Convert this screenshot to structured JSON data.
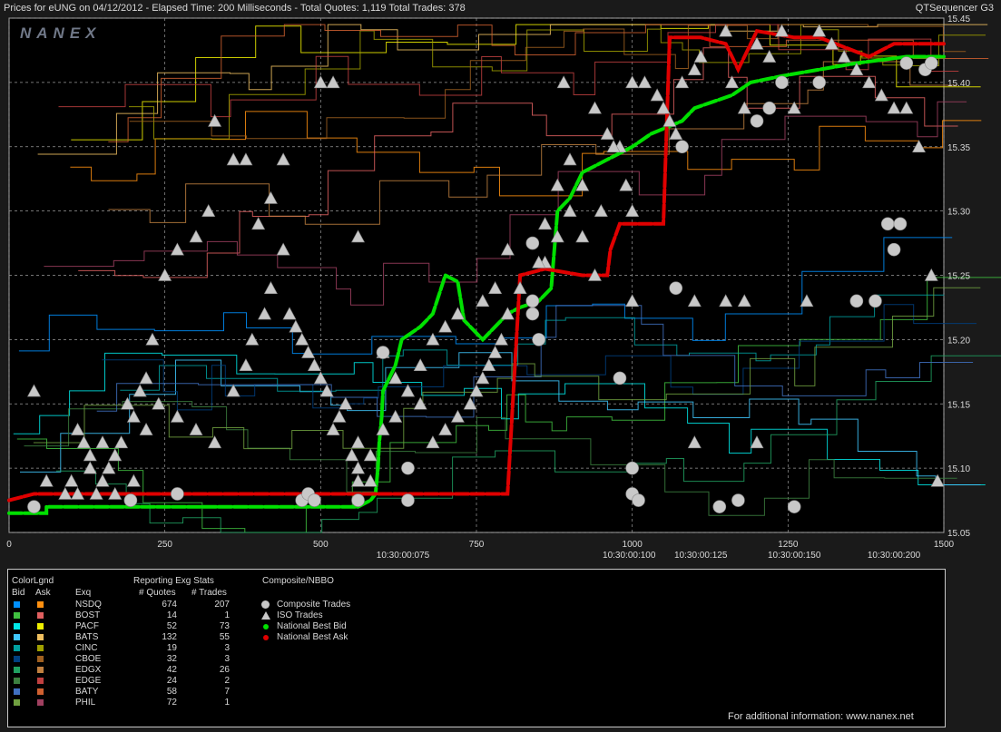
{
  "header": {
    "title": "Prices for  eUNG  on  04/12/2012  -  Elapsed Time: 200 Milliseconds  -  Total Quotes: 1,119  Total Trades: 378",
    "app": "QTSequencer G3"
  },
  "watermark": "NANEX",
  "footer": "For additional information: www.nanex.net",
  "chart_data": {
    "type": "line",
    "title": "Prices for  eUNG  on  04/12/2012",
    "y_ticks": [
      "15.05",
      "15.10",
      "15.15",
      "15.20",
      "15.25",
      "15.30",
      "15.35",
      "15.40",
      "15.45"
    ],
    "ylim": [
      15.05,
      15.45
    ],
    "x_ticks": [
      "0",
      "250",
      "500",
      "750",
      "1000",
      "1250",
      "1500"
    ],
    "xlim": [
      0,
      1500
    ],
    "time_ticks": [
      {
        "x": 632,
        "label": "10:30:00:075"
      },
      {
        "x": 995,
        "label": "10:30:00:100"
      },
      {
        "x": 1110,
        "label": "10:30:00:125"
      },
      {
        "x": 1260,
        "label": "10:30:00:150"
      },
      {
        "x": 1420,
        "label": "10:30:00:200"
      }
    ],
    "grid": true,
    "colors": {
      "background": "#000000",
      "grid": "#9a9a9a",
      "bid": "#00e000",
      "ask": "#e00000",
      "trade": "#c8c8c8"
    },
    "series": [
      {
        "name": "National Best Bid",
        "points": [
          [
            0,
            15.065
          ],
          [
            60,
            15.065
          ],
          [
            60,
            15.07
          ],
          [
            300,
            15.07
          ],
          [
            560,
            15.07
          ],
          [
            580,
            15.075
          ],
          [
            588,
            15.08
          ],
          [
            590,
            15.09
          ],
          [
            592,
            15.1
          ],
          [
            594,
            15.12
          ],
          [
            598,
            15.14
          ],
          [
            600,
            15.16
          ],
          [
            610,
            15.17
          ],
          [
            620,
            15.18
          ],
          [
            625,
            15.19
          ],
          [
            630,
            15.2
          ],
          [
            660,
            15.21
          ],
          [
            680,
            15.22
          ],
          [
            700,
            15.25
          ],
          [
            720,
            15.245
          ],
          [
            730,
            15.215
          ],
          [
            760,
            15.2
          ],
          [
            780,
            15.21
          ],
          [
            800,
            15.22
          ],
          [
            820,
            15.225
          ],
          [
            850,
            15.23
          ],
          [
            870,
            15.24
          ],
          [
            880,
            15.3
          ],
          [
            900,
            15.31
          ],
          [
            920,
            15.33
          ],
          [
            960,
            15.34
          ],
          [
            1000,
            15.35
          ],
          [
            1030,
            15.36
          ],
          [
            1080,
            15.37
          ],
          [
            1100,
            15.38
          ],
          [
            1160,
            15.39
          ],
          [
            1190,
            15.4
          ],
          [
            1240,
            15.405
          ],
          [
            1300,
            15.41
          ],
          [
            1360,
            15.415
          ],
          [
            1440,
            15.42
          ],
          [
            1500,
            15.42
          ]
        ]
      },
      {
        "name": "National Best Ask",
        "points": [
          [
            0,
            15.075
          ],
          [
            40,
            15.08
          ],
          [
            560,
            15.08
          ],
          [
            600,
            15.08
          ],
          [
            800,
            15.08
          ],
          [
            820,
            15.25
          ],
          [
            860,
            15.255
          ],
          [
            920,
            15.25
          ],
          [
            960,
            15.25
          ],
          [
            965,
            15.27
          ],
          [
            980,
            15.29
          ],
          [
            1050,
            15.29
          ],
          [
            1060,
            15.435
          ],
          [
            1110,
            15.435
          ],
          [
            1150,
            15.43
          ],
          [
            1170,
            15.41
          ],
          [
            1200,
            15.44
          ],
          [
            1260,
            15.435
          ],
          [
            1300,
            15.435
          ],
          [
            1380,
            15.42
          ],
          [
            1420,
            15.43
          ],
          [
            1440,
            15.43
          ],
          [
            1460,
            15.43
          ],
          [
            1480,
            15.43
          ],
          [
            1500,
            15.43
          ]
        ]
      }
    ],
    "composite_trades": [
      [
        40,
        15.07
      ],
      [
        195,
        15.075
      ],
      [
        270,
        15.08
      ],
      [
        470,
        15.075
      ],
      [
        480,
        15.08
      ],
      [
        490,
        15.075
      ],
      [
        560,
        15.075
      ],
      [
        600,
        15.19
      ],
      [
        640,
        15.075
      ],
      [
        640,
        15.1
      ],
      [
        840,
        15.275
      ],
      [
        840,
        15.23
      ],
      [
        840,
        15.22
      ],
      [
        850,
        15.2
      ],
      [
        980,
        15.17
      ],
      [
        1000,
        15.1
      ],
      [
        1000,
        15.08
      ],
      [
        1010,
        15.075
      ],
      [
        1070,
        15.24
      ],
      [
        1080,
        15.35
      ],
      [
        1140,
        15.07
      ],
      [
        1170,
        15.075
      ],
      [
        1200,
        15.37
      ],
      [
        1220,
        15.38
      ],
      [
        1240,
        15.4
      ],
      [
        1260,
        15.07
      ],
      [
        1300,
        15.4
      ],
      [
        1360,
        15.23
      ],
      [
        1390,
        15.23
      ],
      [
        1410,
        15.29
      ],
      [
        1420,
        15.27
      ],
      [
        1430,
        15.29
      ],
      [
        1440,
        15.415
      ],
      [
        1470,
        15.41
      ],
      [
        1480,
        15.415
      ]
    ],
    "iso_trades": [
      [
        40,
        15.16
      ],
      [
        60,
        15.09
      ],
      [
        110,
        15.08
      ],
      [
        130,
        15.1
      ],
      [
        150,
        15.12
      ],
      [
        170,
        15.08
      ],
      [
        200,
        15.09
      ],
      [
        220,
        15.13
      ],
      [
        240,
        15.15
      ],
      [
        270,
        15.14
      ],
      [
        300,
        15.13
      ],
      [
        330,
        15.12
      ],
      [
        360,
        15.16
      ],
      [
        380,
        15.18
      ],
      [
        390,
        15.2
      ],
      [
        410,
        15.22
      ],
      [
        420,
        15.24
      ],
      [
        440,
        15.27
      ],
      [
        460,
        15.21
      ],
      [
        480,
        15.19
      ],
      [
        500,
        15.17
      ],
      [
        520,
        15.13
      ],
      [
        540,
        15.15
      ],
      [
        560,
        15.12
      ],
      [
        580,
        15.09
      ],
      [
        320,
        15.3
      ],
      [
        300,
        15.28
      ],
      [
        270,
        15.27
      ],
      [
        250,
        15.25
      ],
      [
        230,
        15.2
      ],
      [
        220,
        15.17
      ],
      [
        210,
        15.16
      ],
      [
        200,
        15.14
      ],
      [
        190,
        15.15
      ],
      [
        180,
        15.12
      ],
      [
        170,
        15.11
      ],
      [
        160,
        15.1
      ],
      [
        150,
        15.09
      ],
      [
        140,
        15.08
      ],
      [
        130,
        15.11
      ],
      [
        120,
        15.12
      ],
      [
        110,
        15.13
      ],
      [
        100,
        15.09
      ],
      [
        90,
        15.08
      ],
      [
        330,
        15.37
      ],
      [
        360,
        15.34
      ],
      [
        380,
        15.34
      ],
      [
        400,
        15.29
      ],
      [
        420,
        15.31
      ],
      [
        440,
        15.34
      ],
      [
        450,
        15.22
      ],
      [
        470,
        15.2
      ],
      [
        490,
        15.18
      ],
      [
        510,
        15.16
      ],
      [
        530,
        15.14
      ],
      [
        550,
        15.11
      ],
      [
        560,
        15.1
      ],
      [
        500,
        15.4
      ],
      [
        520,
        15.4
      ],
      [
        560,
        15.28
      ],
      [
        600,
        15.19
      ],
      [
        620,
        15.17
      ],
      [
        640,
        15.16
      ],
      [
        660,
        15.15
      ],
      [
        680,
        15.12
      ],
      [
        700,
        15.13
      ],
      [
        720,
        15.14
      ],
      [
        740,
        15.15
      ],
      [
        750,
        15.16
      ],
      [
        760,
        15.17
      ],
      [
        770,
        15.18
      ],
      [
        780,
        15.19
      ],
      [
        790,
        15.2
      ],
      [
        800,
        15.22
      ],
      [
        820,
        15.24
      ],
      [
        860,
        15.26
      ],
      [
        880,
        15.28
      ],
      [
        900,
        15.3
      ],
      [
        920,
        15.32
      ],
      [
        940,
        15.38
      ],
      [
        960,
        15.36
      ],
      [
        980,
        15.35
      ],
      [
        990,
        15.32
      ],
      [
        1000,
        15.4
      ],
      [
        1020,
        15.4
      ],
      [
        1040,
        15.39
      ],
      [
        1050,
        15.38
      ],
      [
        1060,
        15.37
      ],
      [
        1070,
        15.36
      ],
      [
        1080,
        15.4
      ],
      [
        1100,
        15.41
      ],
      [
        1110,
        15.42
      ],
      [
        1150,
        15.44
      ],
      [
        1160,
        15.4
      ],
      [
        1180,
        15.38
      ],
      [
        1200,
        15.43
      ],
      [
        1220,
        15.42
      ],
      [
        1240,
        15.44
      ],
      [
        1260,
        15.38
      ],
      [
        1300,
        15.44
      ],
      [
        1320,
        15.43
      ],
      [
        1340,
        15.42
      ],
      [
        1360,
        15.41
      ],
      [
        1380,
        15.4
      ],
      [
        1400,
        15.39
      ],
      [
        1420,
        15.38
      ],
      [
        1440,
        15.38
      ],
      [
        1460,
        15.35
      ],
      [
        1480,
        15.25
      ],
      [
        1490,
        15.09
      ],
      [
        1100,
        15.23
      ],
      [
        1150,
        15.23
      ],
      [
        1180,
        15.23
      ],
      [
        1280,
        15.23
      ],
      [
        1000,
        15.23
      ],
      [
        1000,
        15.3
      ],
      [
        1200,
        15.12
      ],
      [
        1100,
        15.12
      ],
      [
        950,
        15.3
      ],
      [
        970,
        15.35
      ],
      [
        940,
        15.25
      ],
      [
        920,
        15.28
      ],
      [
        900,
        15.34
      ],
      [
        890,
        15.4
      ],
      [
        880,
        15.32
      ],
      [
        860,
        15.29
      ],
      [
        850,
        15.26
      ],
      [
        800,
        15.27
      ],
      [
        780,
        15.24
      ],
      [
        760,
        15.23
      ],
      [
        720,
        15.22
      ],
      [
        700,
        15.21
      ],
      [
        680,
        15.2
      ],
      [
        660,
        15.18
      ],
      [
        640,
        15.16
      ],
      [
        620,
        15.14
      ],
      [
        600,
        15.13
      ],
      [
        580,
        15.11
      ],
      [
        560,
        15.09
      ]
    ]
  },
  "legend": {
    "colorlgnd": "ColorLgnd",
    "bid": "Bid",
    "ask": "Ask",
    "exq": "Exq",
    "stats_title": "Reporting Exg Stats",
    "quotes_header": "# Quotes",
    "trades_header": "# Trades",
    "composite_title": "Composite/NBBO",
    "exchanges": [
      {
        "name": "NSDQ",
        "quotes": "674",
        "trades": "207",
        "bid_color": "#0090ff",
        "ask_color": "#ff9010"
      },
      {
        "name": "BOST",
        "quotes": "14",
        "trades": "1",
        "bid_color": "#40c040",
        "ask_color": "#e06060"
      },
      {
        "name": "PACF",
        "quotes": "52",
        "trades": "73",
        "bid_color": "#00e8e8",
        "ask_color": "#f0f000"
      },
      {
        "name": "BATS",
        "quotes": "132",
        "trades": "55",
        "bid_color": "#40c8ff",
        "ask_color": "#f0c060"
      },
      {
        "name": "CINC",
        "quotes": "19",
        "trades": "3",
        "bid_color": "#00a0a0",
        "ask_color": "#a0a000"
      },
      {
        "name": "CBOE",
        "quotes": "32",
        "trades": "3",
        "bid_color": "#004080",
        "ask_color": "#a06020"
      },
      {
        "name": "EDGX",
        "quotes": "42",
        "trades": "26",
        "bid_color": "#20a060",
        "ask_color": "#c08040"
      },
      {
        "name": "EDGE",
        "quotes": "24",
        "trades": "2",
        "bid_color": "#3c8040",
        "ask_color": "#c04040"
      },
      {
        "name": "BATY",
        "quotes": "58",
        "trades": "7",
        "bid_color": "#4070c0",
        "ask_color": "#d06030"
      },
      {
        "name": "PHIL",
        "quotes": "72",
        "trades": "1",
        "bid_color": "#70a040",
        "ask_color": "#a04060"
      }
    ],
    "markers": [
      {
        "label": "Composite Trades",
        "kind": "circle",
        "color": "#c8c8c8"
      },
      {
        "label": "ISO Trades",
        "kind": "triangle",
        "color": "#c8c8c8"
      },
      {
        "label": "National Best Bid",
        "kind": "dot",
        "color": "#00e000"
      },
      {
        "label": "National Best Ask",
        "kind": "dot",
        "color": "#e00000"
      }
    ]
  }
}
